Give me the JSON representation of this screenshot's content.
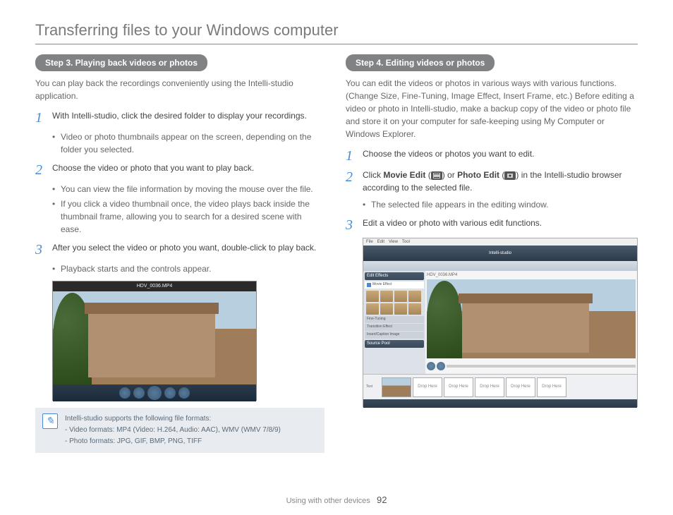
{
  "title": "Transferring files to your Windows computer",
  "left": {
    "header": "Step 3. Playing back videos or photos",
    "intro": "You can play back the recordings conveniently using the Intelli-studio application.",
    "s1": "With Intelli-studio, click the desired folder to display your recordings.",
    "s1b1": "Video or photo thumbnails appear on the screen, depending on the folder you selected.",
    "s2": "Choose the video or photo that you want to play back.",
    "s2b1": "You can view the file information by moving the mouse over the file.",
    "s2b2": "If you click a video thumbnail once, the video plays back inside the thumbnail frame, allowing you to search for a desired scene with ease.",
    "s3": "After you select the video or photo you want, double-click to play back.",
    "s3b1": "Playback starts and the controls appear.",
    "player_title": "HDV_0036.MP4"
  },
  "note": {
    "l1": "Intelli-studio supports the following file formats:",
    "l2": "- Video formats: MP4 (Video: H.264, Audio: AAC), WMV (WMV 7/8/9)",
    "l3": "- Photo formats: JPG, GIF, BMP, PNG, TIFF"
  },
  "right": {
    "header": "Step 4. Editing videos or photos",
    "intro": "You can edit the videos or photos in various ways with various functions. (Change Size, Fine-Tuning, Image Effect, Insert Frame, etc.) Before editing a video or photo in Intelli-studio, make a backup copy of the video or photo file and store it on your computer for safe-keeping using My Computer or Windows Explorer.",
    "s1": "Choose the videos or photos you want to edit.",
    "s2a": "Click ",
    "s2_me": "Movie Edit",
    "s2_or": " or ",
    "s2_pe": "Photo Edit",
    "s2b": " in the Intelli-studio browser according to the selected file.",
    "s2bullet": "The selected file appears in the editing window.",
    "s3": "Edit a video or photo with various edit functions.",
    "app_title": "Intelli-studio",
    "side_edit": "Edit Effects",
    "side_movie": "Movie Effect",
    "side_fine": "Fine-Tuning",
    "side_trans": "Transition Effect",
    "side_insert": "Insert/Caption Image",
    "side_pool": "Source Pool",
    "drop": "Drop Here",
    "preview_file": "HDV_0036.MP4"
  },
  "footer": {
    "text": "Using with other devices",
    "page": "92"
  }
}
